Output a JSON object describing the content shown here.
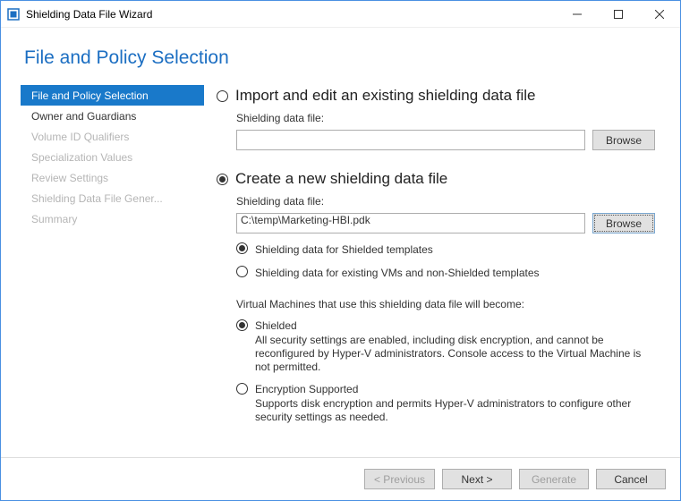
{
  "window": {
    "title": "Shielding Data File Wizard"
  },
  "header": {
    "title": "File and Policy Selection"
  },
  "sidebar": {
    "items": [
      {
        "label": "File and Policy Selection",
        "state": "active"
      },
      {
        "label": "Owner and Guardians",
        "state": "enabled"
      },
      {
        "label": "Volume ID Qualifiers",
        "state": "disabled"
      },
      {
        "label": "Specialization Values",
        "state": "disabled"
      },
      {
        "label": "Review Settings",
        "state": "disabled"
      },
      {
        "label": "Shielding Data File Gener...",
        "state": "disabled"
      },
      {
        "label": "Summary",
        "state": "disabled"
      }
    ]
  },
  "main": {
    "import_section": {
      "title": "Import and edit an existing shielding data file",
      "selected": false,
      "file_label": "Shielding data file:",
      "file_value": "",
      "browse": "Browse"
    },
    "create_section": {
      "title": "Create a new shielding data file",
      "selected": true,
      "file_label": "Shielding data file:",
      "file_value": "C:\\temp\\Marketing-HBI.pdk",
      "browse": "Browse",
      "template_options": [
        {
          "label": "Shielding data for Shielded templates",
          "selected": true
        },
        {
          "label": "Shielding data for existing VMs and non-Shielded templates",
          "selected": false
        }
      ],
      "vm_note": "Virtual Machines that use this shielding data file will become:",
      "policy_options": [
        {
          "name": "Shielded",
          "selected": true,
          "desc": "All security settings are enabled, including disk encryption, and cannot be reconfigured by Hyper-V administrators. Console access to the Virtual Machine is not permitted."
        },
        {
          "name": "Encryption Supported",
          "selected": false,
          "desc": "Supports disk encryption and permits Hyper-V administrators to configure other security settings as needed."
        }
      ]
    }
  },
  "footer": {
    "previous": "< Previous",
    "next": "Next >",
    "generate": "Generate",
    "cancel": "Cancel"
  }
}
